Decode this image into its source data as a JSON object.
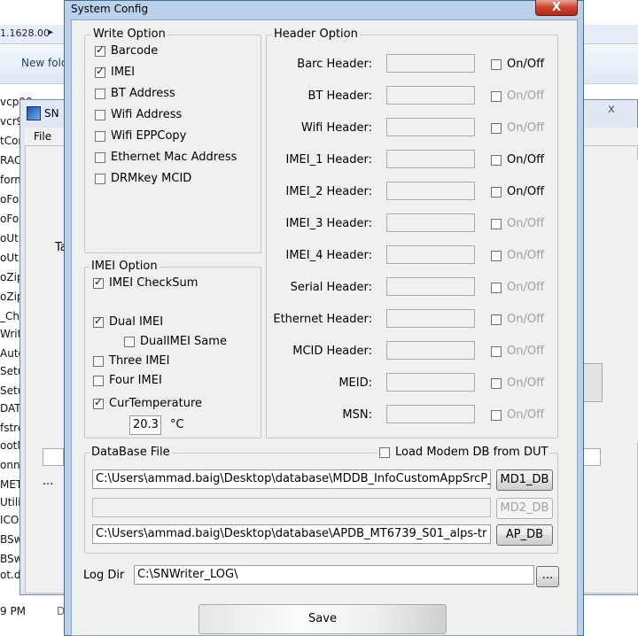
{
  "background": {
    "address_text": "1.1628.00",
    "new_folder": "New fold",
    "files": [
      "vcp90",
      "vcr90",
      "tCom",
      "RAC",
      "form",
      "oFo",
      "oFor",
      "oUti",
      "oUti",
      "oZip",
      "oZip",
      "_Ch",
      "Writ",
      "Auto",
      "Setu",
      "Setu",
      "DATA",
      "fstre",
      "ootN",
      "onnA",
      "META",
      "Utilit",
      "ICOM",
      "BSwitchTool.ex",
      "BSwitchTool.in",
      "ot.dll"
    ],
    "status_left": "9 PM",
    "status_right": "D"
  },
  "sn_window": {
    "title": "SN",
    "menu_file": "File",
    "label_t": "Ta",
    "dots": "...",
    "close": "x"
  },
  "dialog": {
    "title": "System Config",
    "close": "X",
    "write_option": {
      "legend": "Write Option",
      "items": [
        {
          "label": "Barcode",
          "checked": true
        },
        {
          "label": "IMEI",
          "checked": true
        },
        {
          "label": "BT Address",
          "checked": false
        },
        {
          "label": "Wifi Address",
          "checked": false
        },
        {
          "label": "Wifi EPPCopy",
          "checked": false
        },
        {
          "label": "Ethernet Mac Address",
          "checked": false
        },
        {
          "label": "DRMkey MCID",
          "checked": false
        }
      ]
    },
    "imei_option": {
      "legend": "IMEI Option",
      "checksum": "IMEI CheckSum",
      "dual": "Dual IMEI",
      "dual_same": "DualIMEI Same",
      "three": "Three IMEI",
      "four": "Four IMEI",
      "cur_temp": "CurTemperature",
      "temp_value": "20.3",
      "temp_unit": "°C"
    },
    "header_option": {
      "legend": "Header Option",
      "onoff": "On/Off",
      "rows": [
        {
          "label": "Barc Header:",
          "enabled": true
        },
        {
          "label": "BT Header:",
          "enabled": false
        },
        {
          "label": "Wifi Header:",
          "enabled": false
        },
        {
          "label": "IMEI_1 Header:",
          "enabled": true
        },
        {
          "label": "IMEI_2 Header:",
          "enabled": true
        },
        {
          "label": "IMEI_3 Header:",
          "enabled": false
        },
        {
          "label": "IMEI_4 Header:",
          "enabled": false
        },
        {
          "label": "Serial Header:",
          "enabled": false
        },
        {
          "label": "Ethernet Header:",
          "enabled": false
        },
        {
          "label": "MCID Header:",
          "enabled": false
        },
        {
          "label": "MEID:",
          "enabled": false
        },
        {
          "label": "MSN:",
          "enabled": false
        }
      ]
    },
    "database": {
      "legend": "DataBase File",
      "load_modem": "Load Modem DB from DUT",
      "md1_path": "C:\\Users\\ammad.baig\\Desktop\\database\\MDDB_InfoCustomAppSrcP_",
      "md1_button": "MD1_DB",
      "md2_path": "",
      "md2_button": "MD2_DB",
      "ap_path": "C:\\Users\\ammad.baig\\Desktop\\database\\APDB_MT6739_S01_alps-tr",
      "ap_button": "AP_DB"
    },
    "log": {
      "label": "Log Dir",
      "value": "C:\\SNWriter_LOG\\",
      "browse": "..."
    },
    "save": "Save"
  }
}
